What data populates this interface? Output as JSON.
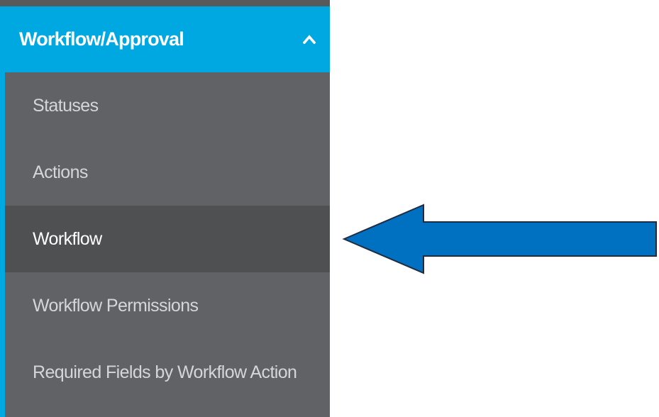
{
  "colors": {
    "sidebar_bg": "#606266",
    "header_bg": "#00a8e2",
    "active_item_bg": "#4f5052",
    "item_text": "#d4d6d8",
    "active_text": "#ffffff",
    "arrow_fill": "#0070c0",
    "arrow_stroke": "#1f2d44"
  },
  "sidebar": {
    "section": {
      "title": "Workflow/Approval",
      "icon": "chevron-up-icon",
      "expanded": true
    },
    "items": [
      {
        "label": "Statuses",
        "active": false
      },
      {
        "label": "Actions",
        "active": false
      },
      {
        "label": "Workflow",
        "active": true
      },
      {
        "label": "Workflow Permissions",
        "active": false
      },
      {
        "label": "Required Fields by Workflow Action",
        "active": false
      }
    ]
  },
  "annotation": {
    "type": "arrow",
    "direction": "left",
    "points_to": "Workflow"
  }
}
